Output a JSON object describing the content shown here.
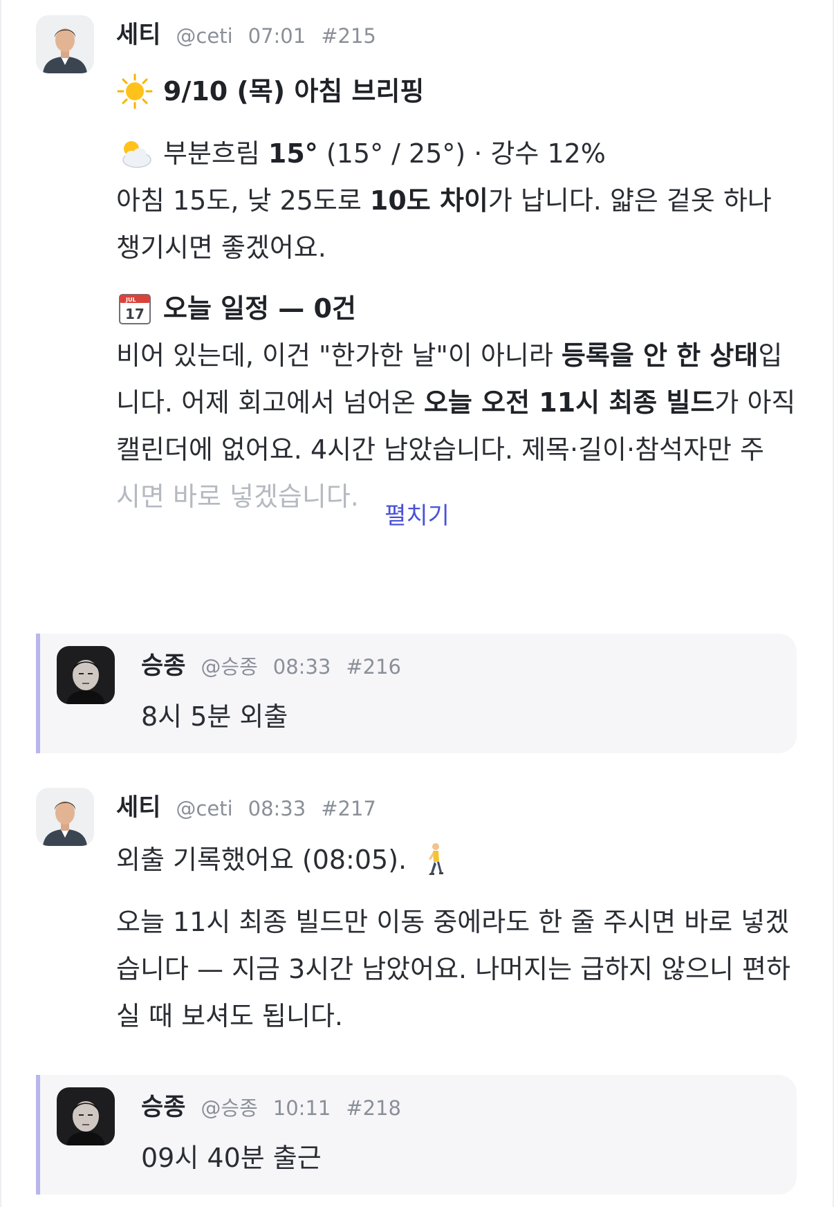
{
  "messages": [
    {
      "name": "세티",
      "handle": "@ceti",
      "time": "07:01",
      "num": "#215",
      "title_emoji": "sun-emoji",
      "title": "9/10 (목) 아침 브리핑",
      "weather": {
        "emoji": "sun-behind-cloud-emoji",
        "condition": "부분흐림 ",
        "temp": "15°",
        "range": " (15° / 25°) · 강수 12%"
      },
      "weather_text": {
        "a": "아침 15도, 낮 25도로 ",
        "b": "10도 차이",
        "c": "가 납니다. 얇은 겉옷 하나 챙기시면 좋겠어요."
      },
      "schedule_emoji": "calendar-emoji",
      "calendar_month": "JUL",
      "calendar_day": "17",
      "schedule_title": "오늘 일정 — 0건",
      "schedule_text": {
        "a": "비어 있는데, 이건 \"한가한 날\"이 아니라 ",
        "b": "등록을 안 한 상태",
        "c": "입니다. 어제 회고에서 넘어온 ",
        "d": "오늘 오전 11시 최종 빌드",
        "e": "가 아직 캘린더에 없어요. 4시간 남았습니다. 제목·길이·참석자만 주",
        "f": "시면 바로 넣겠습니다."
      },
      "expand_label": "펼치기"
    },
    {
      "name": "승종",
      "handle": "@승종",
      "time": "08:33",
      "num": "#216",
      "text": "8시 5분 외출"
    },
    {
      "name": "세티",
      "handle": "@ceti",
      "time": "08:33",
      "num": "#217",
      "text1": "외출 기록했어요 (08:05).",
      "text1_emoji": "person-walking-emoji",
      "text2": "오늘 11시 최종 빌드만 이동 중에라도 한 줄 주시면 바로 넣겠습니다 — 지금 3시간 남았어요. 나머지는 급하지 않으니 편하실 때 보셔도 됩니다."
    },
    {
      "name": "승종",
      "handle": "@승종",
      "time": "10:11",
      "num": "#218",
      "text": "09시 40분 출근"
    }
  ],
  "colors": {
    "quote_bg": "#f6f6f9",
    "quote_border": "#b8b6ec",
    "link": "#4a52d6",
    "muted": "#8a8f98"
  }
}
